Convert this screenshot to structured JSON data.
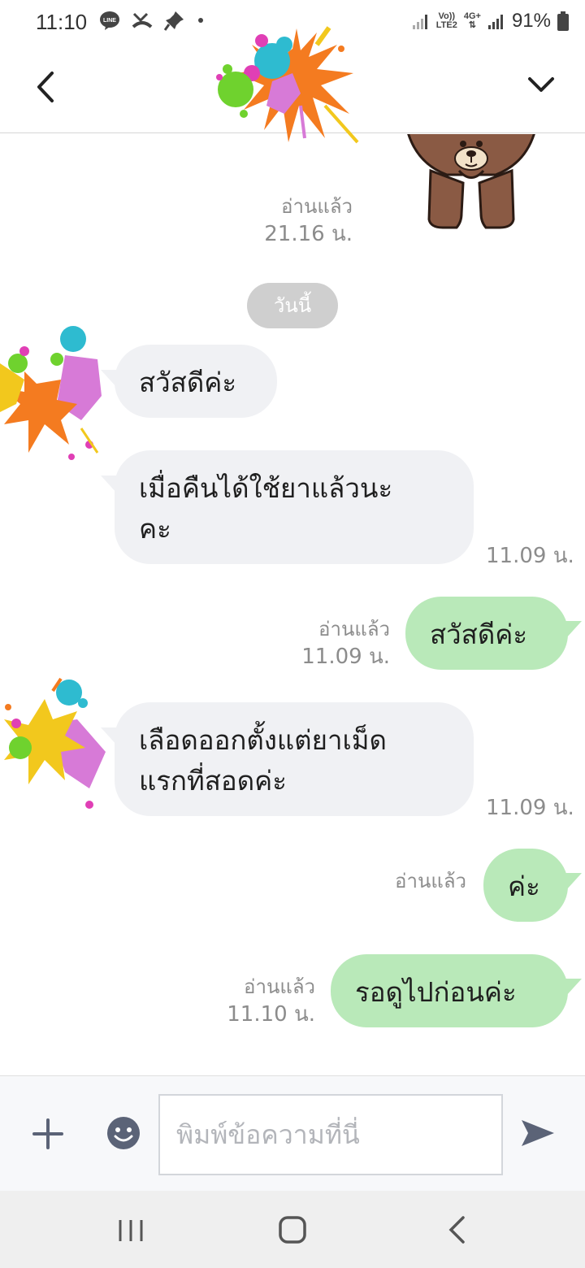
{
  "status_bar": {
    "time": "11:10",
    "battery_percent": "91%",
    "network_top": "Vo))",
    "network_bottom": "LTE2",
    "network_4g": "4G+"
  },
  "header": {
    "contact_avatar": "paint-splash-avatar"
  },
  "thread": {
    "previous_read_label": "อ่านแล้ว",
    "previous_read_time": "21.16 น.",
    "date_divider": "วันนี้"
  },
  "messages": [
    {
      "direction": "incoming",
      "text": "สวัสดีค่ะ"
    },
    {
      "direction": "incoming",
      "text_line1": "เมื่อคืนได้ใช้ยาแล้วนะ",
      "text_line2": "คะ",
      "time": "11.09 น."
    },
    {
      "direction": "outgoing",
      "text": "สวัสดีค่ะ",
      "read_label": "อ่านแล้ว",
      "time": "11.09 น."
    },
    {
      "direction": "incoming",
      "text_line1": "เลือดออกตั้งแต่ยาเม็ด",
      "text_line2": "แรกที่สอดค่ะ",
      "time": "11.09 น."
    },
    {
      "direction": "outgoing",
      "text": "ค่ะ",
      "read_label": "อ่านแล้ว"
    },
    {
      "direction": "outgoing",
      "text": "รอดูไปก่อนค่ะ",
      "read_label": "อ่านแล้ว",
      "time": "11.10 น."
    }
  ],
  "input": {
    "placeholder": "พิมพ์ข้อความที่นี่"
  },
  "colors": {
    "incoming_bubble": "#f0f1f4",
    "outgoing_bubble": "#b9e9b9",
    "meta_text": "#8c8c8c",
    "date_pill": "#cfcfcf",
    "icon_dark": "#5b6377"
  }
}
